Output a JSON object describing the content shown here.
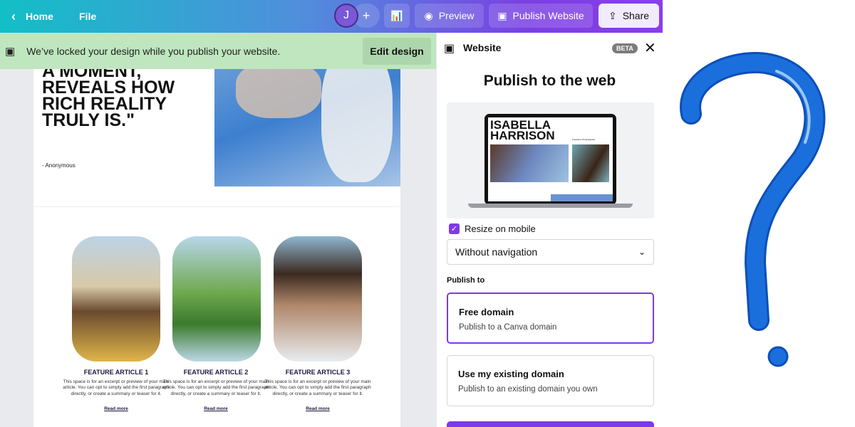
{
  "topbar": {
    "home": "Home",
    "file": "File",
    "avatar": "J",
    "preview": "Preview",
    "publish": "Publish Website",
    "share": "Share"
  },
  "banner": {
    "message": "We’ve locked your design while you publish your website.",
    "edit": "Edit design"
  },
  "design": {
    "quote": "IMAGE, FREEZING A MOMENT, REVEALS HOW RICH REALITY TRULY IS.\"",
    "author": "- Anonymous",
    "articles": [
      {
        "title": "FEATURE ARTICLE 1",
        "body": "This space is for an excerpt or preview of your main article. You can opt to simply add the first paragraph directly, or create a summary or teaser for it.",
        "link": "Read more"
      },
      {
        "title": "FEATURE ARTICLE 2",
        "body": "This space is for an excerpt or preview of your main article. You can opt to simply add the first paragraph directly, or create a summary or teaser for it.",
        "link": "Read more"
      },
      {
        "title": "FEATURE ARTICLE 3",
        "body": "This space is for an excerpt or preview of your main article. You can opt to simply add the first paragraph directly, or create a summary or teaser for it.",
        "link": "Read more"
      }
    ]
  },
  "panel": {
    "header": "Website",
    "badge": "BETA",
    "title": "Publish to the web",
    "preview_name": "ISABELLA HARRISON",
    "preview_sub": "Freelance Photographer",
    "resize_label": "Resize on mobile",
    "resize_checked": true,
    "nav_select": "Without navigation",
    "publish_to": "Publish to",
    "options": [
      {
        "title": "Free domain",
        "sub": "Publish to a Canva domain",
        "selected": true
      },
      {
        "title": "Use my existing domain",
        "sub": "Publish to an existing domain you own",
        "selected": false
      }
    ]
  },
  "colors": {
    "accent": "#7d3ae8",
    "banner": "#bfe6bf",
    "question_mark": "#1565d0"
  }
}
